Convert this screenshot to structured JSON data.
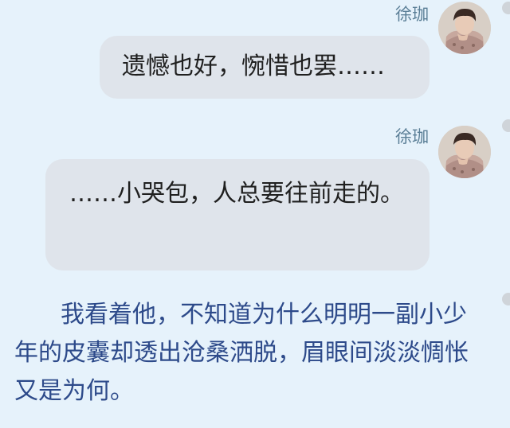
{
  "messages": [
    {
      "sender": "徐珈",
      "text": "遗憾也好，惋惜也罢……"
    },
    {
      "sender": "徐珈",
      "text": "……小哭包，人总要往前走的。"
    }
  ],
  "narration": "我看着他，不知道为什么明明一副小少年的皮囊却透出沧桑洒脱，眉眼间淡淡惆怅又是为何。",
  "colors": {
    "background": "#e6f2fb",
    "bubble": "#dfe4eb",
    "sender_name": "#5a7e96",
    "narration": "#2d4a8a"
  },
  "icons": [
    "avatar-photo",
    "more-dot"
  ]
}
